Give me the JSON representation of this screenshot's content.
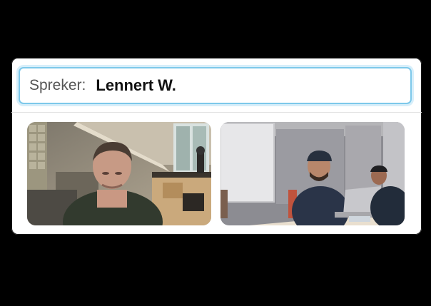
{
  "speaker": {
    "label": "Spreker:",
    "name": "Lennert W."
  },
  "colors": {
    "background": "#000000",
    "panel": "#ffffff",
    "focus_border": "#7dc8ea"
  },
  "video_tiles": [
    {
      "icon": "video-feed-home-office"
    },
    {
      "icon": "video-feed-meeting-room"
    }
  ]
}
